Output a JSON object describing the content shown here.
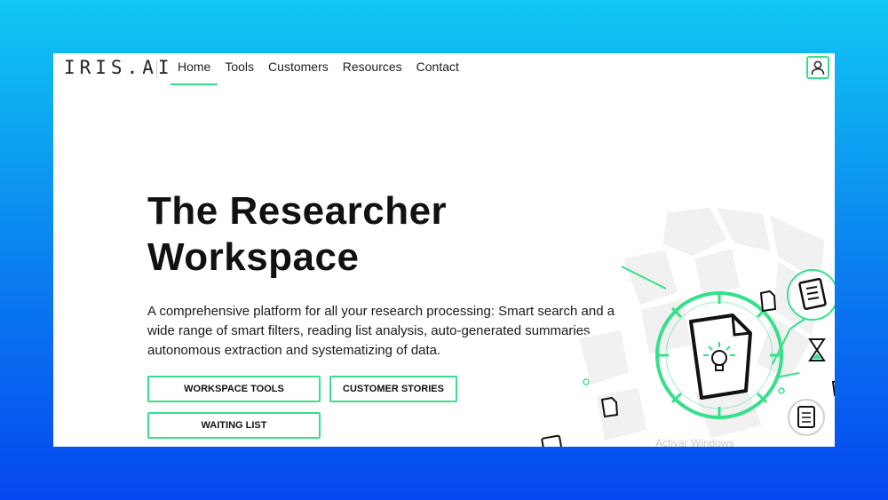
{
  "brand": {
    "logo_text": "IRIS.AI"
  },
  "nav": {
    "items": [
      {
        "label": "Home",
        "active": true
      },
      {
        "label": "Tools",
        "active": false
      },
      {
        "label": "Customers",
        "active": false
      },
      {
        "label": "Resources",
        "active": false
      },
      {
        "label": "Contact",
        "active": false
      }
    ]
  },
  "account": {
    "icon": "user-icon"
  },
  "hero": {
    "title_line1": "The Researcher",
    "title_line2": "Workspace",
    "description": "A comprehensive platform for all your research processing: Smart search and a wide range of smart filters, reading list analysis, auto-generated summaries, autonomous extraction and systematizing of data."
  },
  "buttons": {
    "workspace_tools": "WORKSPACE TOOLS",
    "customer_stories": "CUSTOMER STORIES",
    "waiting_list": "WAITING LIST"
  },
  "overlay": {
    "watermark_text": "Activar Windows"
  },
  "colors": {
    "accent": "#36e08a",
    "background_top": "#10c8f2",
    "background_bottom": "#0547f0"
  }
}
